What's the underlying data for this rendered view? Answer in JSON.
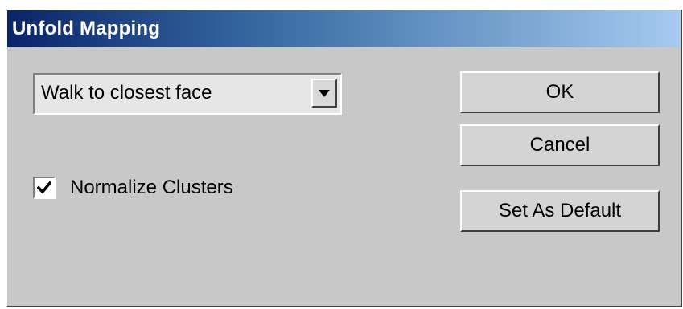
{
  "window": {
    "title": "Unfold Mapping"
  },
  "mapping_dropdown": {
    "selected": "Walk to closest face"
  },
  "normalize_checkbox": {
    "label": "Normalize Clusters",
    "checked": true
  },
  "buttons": {
    "ok": "OK",
    "cancel": "Cancel",
    "set_default": "Set As Default"
  },
  "icons": {
    "dropdown_arrow": "chevron-down-icon",
    "checkmark": "checkmark-icon"
  },
  "colors": {
    "title_gradient_start": "#0a246a",
    "title_gradient_end": "#a6caf0",
    "dialog_face": "#c8c8c8"
  }
}
